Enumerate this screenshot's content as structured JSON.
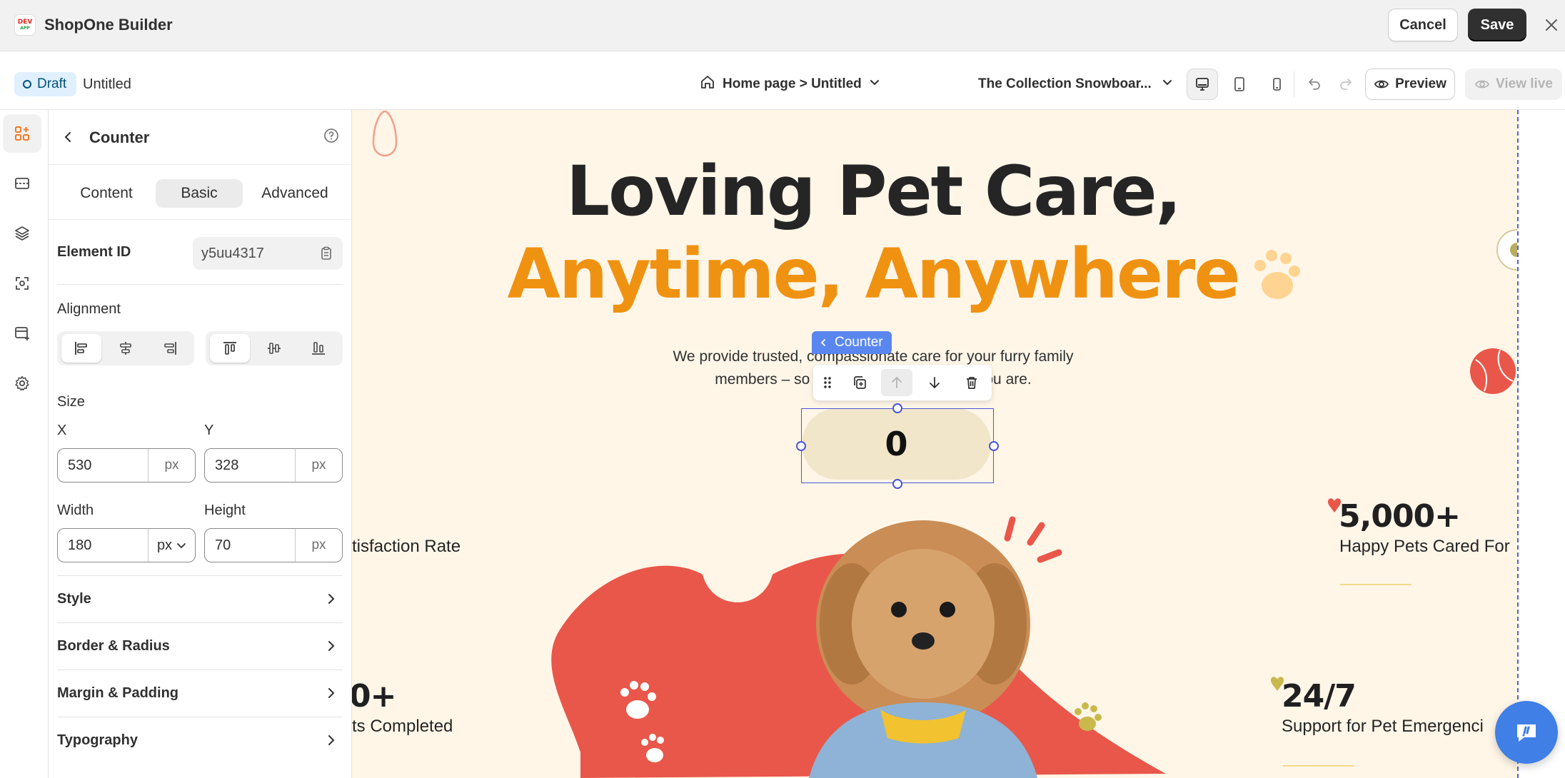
{
  "app": {
    "logo_line1": "DEV",
    "logo_line2": "APP",
    "title": "ShopOne Builder",
    "cancel_label": "Cancel",
    "save_label": "Save"
  },
  "toolbar": {
    "status_badge": "Draft",
    "page_name": "Untitled",
    "breadcrumb": "Home page > Untitled",
    "store_name": "The Collection Snowboar...",
    "preview_label": "Preview",
    "view_live_label": "View live"
  },
  "rail": {
    "items": [
      {
        "name": "elements",
        "icon": "add-element-icon",
        "active": true
      },
      {
        "name": "sections",
        "icon": "sections-icon",
        "active": false
      },
      {
        "name": "layers",
        "icon": "layers-icon",
        "active": false
      },
      {
        "name": "global-styles",
        "icon": "styles-icon",
        "active": false
      },
      {
        "name": "templates",
        "icon": "templates-icon",
        "active": false
      },
      {
        "name": "settings",
        "icon": "gear-icon",
        "active": false
      }
    ]
  },
  "panel": {
    "title": "Counter",
    "tabs": [
      {
        "label": "Content",
        "active": false
      },
      {
        "label": "Basic",
        "active": true
      },
      {
        "label": "Advanced",
        "active": false
      }
    ],
    "element_id_label": "Element ID",
    "element_id_value": "y5uu4317",
    "alignment_label": "Alignment",
    "size_label": "Size",
    "x_label": "X",
    "x_value": "530",
    "x_unit": "px",
    "y_label": "Y",
    "y_value": "328",
    "y_unit": "px",
    "width_label": "Width",
    "width_value": "180",
    "width_unit": "px",
    "height_label": "Height",
    "height_value": "70",
    "height_unit": "px",
    "sections": [
      "Style",
      "Border & Radius",
      "Margin & Padding",
      "Typography"
    ]
  },
  "canvas": {
    "hero_line1": "Loving Pet Care,",
    "hero_line2": "Anytime, Anywhere",
    "subtitle_line1": "We provide trusted, compassionate care for your furry family",
    "subtitle_line2": "members – so you can relax, wherever you are.",
    "selected_label": "Counter",
    "counter_value": "0",
    "stats": [
      {
        "number": "",
        "text": "tisfaction Rate"
      },
      {
        "number": "5,000+",
        "text": "Happy Pets Cared For"
      },
      {
        "number": "0+",
        "text": "ts Completed"
      },
      {
        "number": "24/7",
        "text": "Support for Pet Emergenci"
      }
    ]
  },
  "colors": {
    "accent_orange": "#f09211",
    "canvas_bg": "#fff6e8",
    "heart_red": "#e9574a",
    "selection_blue": "#4b55d6",
    "counter_pill": "#f1e6c9"
  }
}
